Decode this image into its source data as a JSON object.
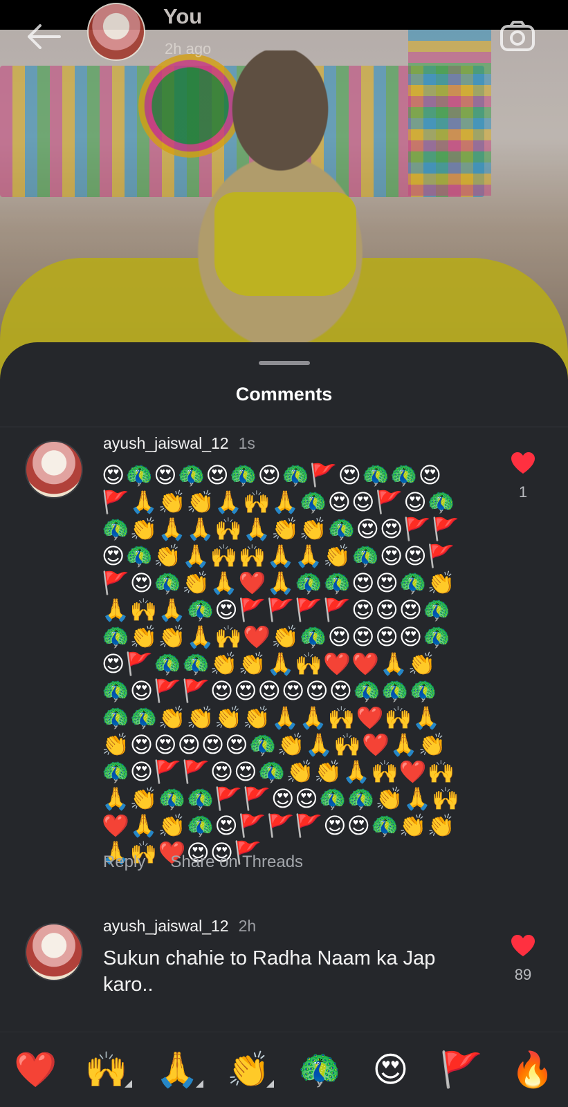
{
  "story": {
    "user": "You",
    "time": "2h ago"
  },
  "sheet": {
    "title": "Comments"
  },
  "comments": [
    {
      "user": "ayush_jaiswal_12",
      "time": "1s",
      "emoji_text": "😍🦚😍🦚😍🦚😍🦚🚩😍🦚🦚😍🚩🙏👏👏🙏🙌🙏🦚😍😍🚩😍🦚🦚👏🙏🙏🙌🙏👏👏🦚😍😍🚩🚩😍🦚👏🙏🙌🙌🙏🙏👏🦚😍😍🚩🚩😍🦚👏🙏❤️🙏🦚🦚😍😍🦚👏🙏🙌🙏🦚😍🚩🚩🚩🚩😍😍😍🦚🦚👏👏🙏🙌❤️👏🦚😍😍😍😍🦚😍🚩🦚🦚👏👏🙏🙌❤️❤️🙏👏🦚😍🚩🚩😍😍😍😍😍😍🦚🦚🦚🦚🦚👏👏👏👏🙏🙏🙌❤️🙌🙏👏😍😍😍😍😍🦚👏🙏🙌❤️🙏👏🦚😍🚩🚩😍😍🦚👏👏🙏🙌❤️🙌🙏👏🦚🦚🚩🚩😍😍🦚🦚👏🙏🙌❤️🙏👏🦚😍🚩🚩🚩😍😍🦚👏👏🙏🙌❤️😍😍🚩",
      "likes": "1",
      "reply_label": "Reply",
      "share_label": "Share on Threads"
    },
    {
      "user": "ayush_jaiswal_12",
      "time": "2h",
      "text": "Sukun chahie to Radha Naam ka Jap karo..",
      "likes": "89"
    }
  ],
  "reactions": [
    {
      "emoji": "❤️",
      "name": "heart",
      "more": false
    },
    {
      "emoji": "🙌",
      "name": "raised-hands",
      "more": true
    },
    {
      "emoji": "🙏",
      "name": "folded-hands",
      "more": true
    },
    {
      "emoji": "👏",
      "name": "clapping-hands",
      "more": true
    },
    {
      "emoji": "🦚",
      "name": "peacock",
      "more": false
    },
    {
      "emoji": "😍",
      "name": "heart-eyes",
      "more": false
    },
    {
      "emoji": "🚩",
      "name": "triangular-flag",
      "more": false
    },
    {
      "emoji": "🔥",
      "name": "fire",
      "more": false
    }
  ],
  "colors": {
    "sheet_bg": "#25272b",
    "like_red": "#ff3040",
    "secondary_text": "#9a9ca1"
  }
}
